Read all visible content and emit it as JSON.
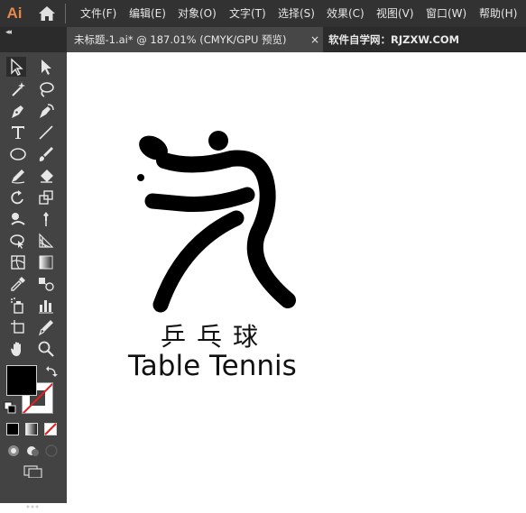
{
  "app": {
    "logo": "Ai",
    "menus": [
      "文件(F)",
      "编辑(E)",
      "对象(O)",
      "文字(T)",
      "选择(S)",
      "效果(C)",
      "视图(V)",
      "窗口(W)",
      "帮助(H)"
    ]
  },
  "tab": {
    "title": "未标题-1.ai* @ 187.01% (CMYK/GPU 预览)",
    "close": "×",
    "watermark": "软件自学网：RJZXW.COM"
  },
  "toolbar": {
    "collapse": "◂◂",
    "tools": [
      "selection-tool",
      "direct-selection-tool",
      "magic-wand-tool",
      "lasso-tool",
      "pen-tool",
      "curvature-tool",
      "type-tool",
      "line-tool",
      "ellipse-tool",
      "paintbrush-tool",
      "shaper-tool",
      "eraser-tool",
      "rotate-tool",
      "scale-tool",
      "warp-tool",
      "puppet-warp-tool",
      "free-transform-tool",
      "perspective-grid-tool",
      "mesh-tool",
      "gradient-tool",
      "eyedropper-tool",
      "blend-tool",
      "symbol-sprayer-tool",
      "column-graph-tool",
      "artboard-tool",
      "slice-tool",
      "hand-tool",
      "zoom-tool"
    ],
    "fill_color": "#000000",
    "stroke_color": "none"
  },
  "canvas": {
    "artwork": "table-tennis-pictogram",
    "chinese_label": "乒乓球",
    "english_label": "Table Tennis"
  },
  "colors": {
    "menubar": "#323232",
    "toolbar": "#434343",
    "tab_active": "#474747",
    "logo": "#e8894a"
  }
}
